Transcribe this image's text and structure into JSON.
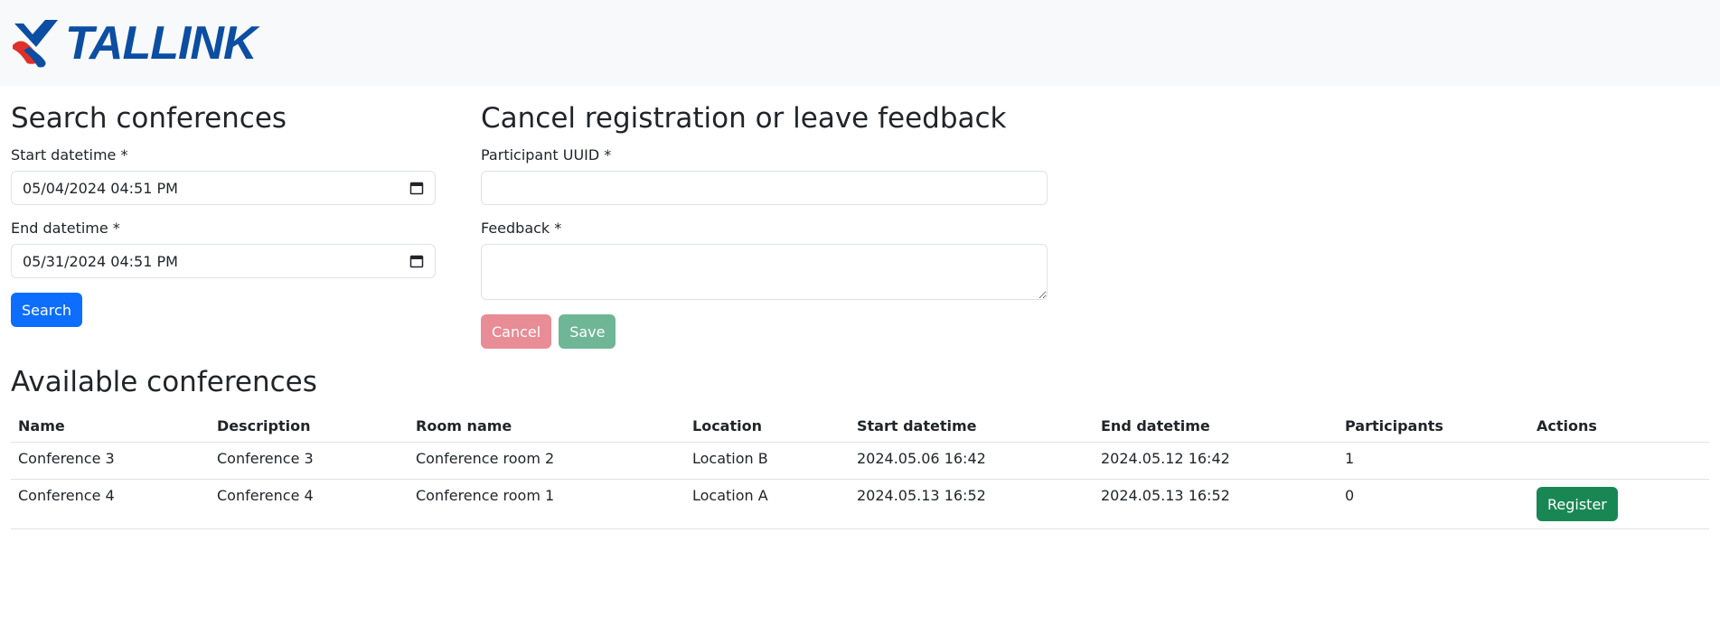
{
  "brand": {
    "name": "TALLINK",
    "colors": {
      "text": "#0b4ea2",
      "wave_red": "#e0302a",
      "wave_blue": "#0b4ea2"
    }
  },
  "search": {
    "heading": "Search conferences",
    "start_label": "Start datetime *",
    "start_value": "05/04/2024 04:51 PM",
    "end_label": "End datetime *",
    "end_value": "05/31/2024 04:51 PM",
    "button": "Search"
  },
  "feedback": {
    "heading": "Cancel registration or leave feedback",
    "uuid_label": "Participant UUID *",
    "uuid_value": "",
    "feedback_label": "Feedback *",
    "feedback_value": "",
    "cancel_button": "Cancel",
    "save_button": "Save"
  },
  "conferences": {
    "heading": "Available conferences",
    "columns": [
      "Name",
      "Description",
      "Room name",
      "Location",
      "Start datetime",
      "End datetime",
      "Participants",
      "Actions"
    ],
    "rows": [
      {
        "name": "Conference 3",
        "description": "Conference 3",
        "room": "Conference room 2",
        "location": "Location B",
        "start": "2024.05.06 16:42",
        "end": "2024.05.12 16:42",
        "participants": "1",
        "action": ""
      },
      {
        "name": "Conference 4",
        "description": "Conference 4",
        "room": "Conference room 1",
        "location": "Location A",
        "start": "2024.05.13 16:52",
        "end": "2024.05.13 16:52",
        "participants": "0",
        "action": "Register"
      }
    ]
  },
  "colors": {
    "primary": "#0d6efd",
    "danger_disabled": "#e88c95",
    "success_disabled": "#6fb696",
    "success": "#198754",
    "navbar_bg": "#f8f9fa"
  }
}
